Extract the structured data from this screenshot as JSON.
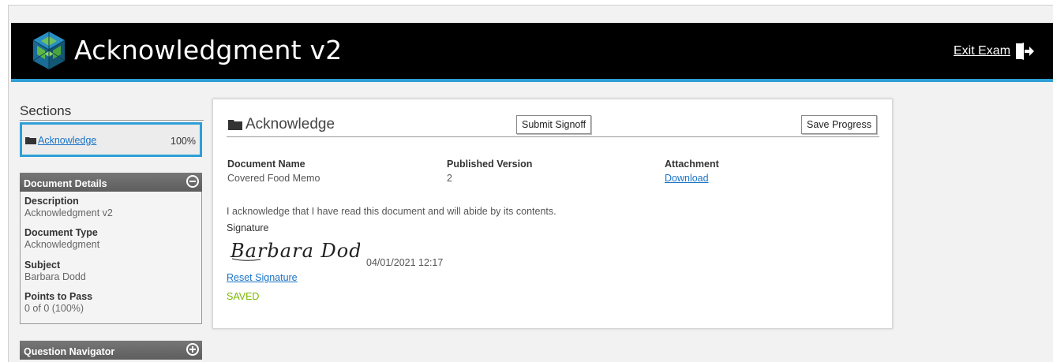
{
  "header": {
    "title": "Acknowledgment v2",
    "exit_label": "Exit Exam",
    "logo_icon": "cube-logo-icon",
    "exit_icon": "exit-door-icon",
    "bar_color": "#000000",
    "accent_color": "#2e9fd6"
  },
  "sidebar": {
    "sections_title": "Sections",
    "sections": [
      {
        "label": "Acknowledge",
        "percent": "100%",
        "icon": "folder-icon"
      }
    ],
    "document_details": {
      "title": "Document Details",
      "toggle_icon": "collapse-minus-icon",
      "fields": [
        {
          "label": "Description",
          "value": "Acknowledgment v2"
        },
        {
          "label": "Document Type",
          "value": "Acknowledgment"
        },
        {
          "label": "Subject",
          "value": "Barbara Dodd"
        },
        {
          "label": "Points to Pass",
          "value": "0 of 0 (100%)"
        }
      ]
    },
    "question_navigator": {
      "title": "Question Navigator",
      "toggle_icon": "expand-plus-icon"
    }
  },
  "main": {
    "section_title": "Acknowledge",
    "submit_button": "Submit Signoff",
    "save_button": "Save Progress",
    "columns": [
      {
        "header": "Document Name",
        "value": "Covered Food Memo"
      },
      {
        "header": "Published Version",
        "value": "2"
      },
      {
        "header": "Attachment",
        "value": "Download"
      }
    ],
    "acknowledgement_text": "I acknowledge that I have read this document and will abide by its contents.",
    "signature_label": "Signature",
    "signature_name": "Barbara Dodd",
    "signature_date": "04/01/2021 12:17",
    "reset_link": "Reset Signature",
    "status": "SAVED",
    "status_color": "#7ab800"
  }
}
